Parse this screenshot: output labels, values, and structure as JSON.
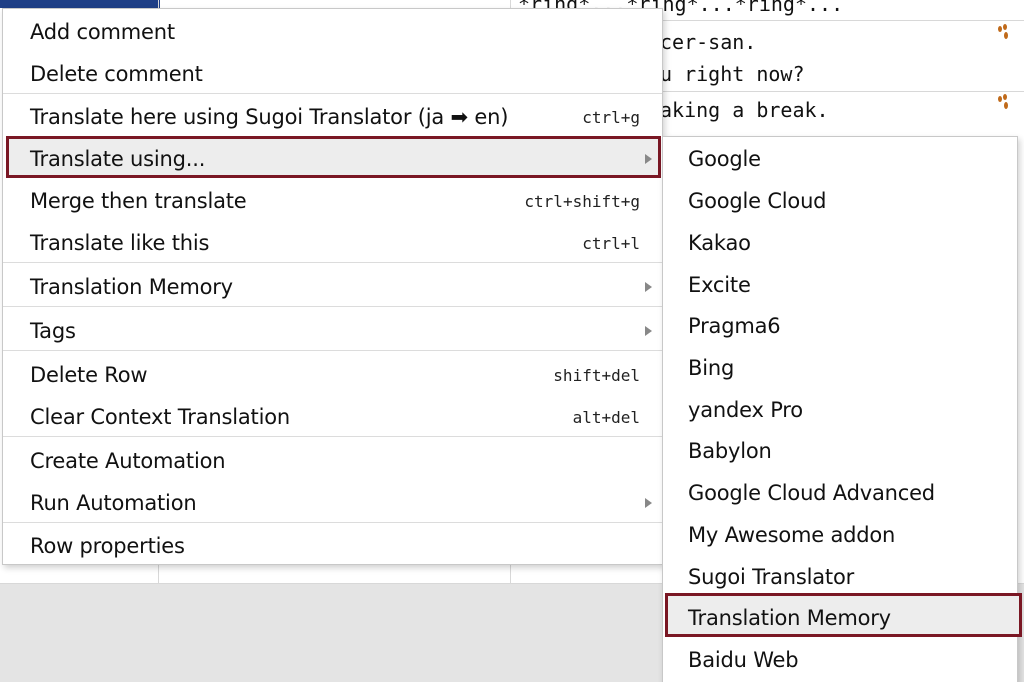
{
  "background": {
    "rows": [
      "*ring*...*ring*...*ring*...",
      "cer-san.",
      "u right now?",
      "aking a break."
    ]
  },
  "context_menu": {
    "items": [
      {
        "label": "Add comment",
        "shortcut": "",
        "submenu": false
      },
      {
        "label": "Delete comment",
        "shortcut": "",
        "submenu": false
      },
      {
        "label": "Translate here using Sugoi Translator (ja ➡ en)",
        "shortcut": "ctrl+g",
        "submenu": false
      },
      {
        "label": "Translate using...",
        "shortcut": "",
        "submenu": true
      },
      {
        "label": "Merge then translate",
        "shortcut": "ctrl+shift+g",
        "submenu": false
      },
      {
        "label": "Translate like this",
        "shortcut": "ctrl+l",
        "submenu": false
      },
      {
        "label": "Translation Memory",
        "shortcut": "",
        "submenu": true
      },
      {
        "label": "Tags",
        "shortcut": "",
        "submenu": true
      },
      {
        "label": "Delete Row",
        "shortcut": "shift+del",
        "submenu": false
      },
      {
        "label": "Clear Context Translation",
        "shortcut": "alt+del",
        "submenu": false
      },
      {
        "label": "Create Automation",
        "shortcut": "",
        "submenu": false
      },
      {
        "label": "Run Automation",
        "shortcut": "",
        "submenu": true
      },
      {
        "label": "Row properties",
        "shortcut": "",
        "submenu": false
      }
    ],
    "highlighted_item": "Translate using..."
  },
  "translate_submenu": {
    "items": [
      "Google",
      "Google Cloud",
      "Kakao",
      "Excite",
      "Pragma6",
      "Bing",
      "yandex Pro",
      "Babylon",
      "Google Cloud Advanced",
      "My Awesome addon",
      "Sugoi Translator",
      "Translation Memory",
      "Baidu Web"
    ],
    "highlighted_item": "Translation Memory"
  },
  "colors": {
    "highlight_border": "#7a1724",
    "highlight_fill": "#ededed",
    "header_blue": "#1f3f86",
    "footprint_icon": "#c06a1a"
  }
}
